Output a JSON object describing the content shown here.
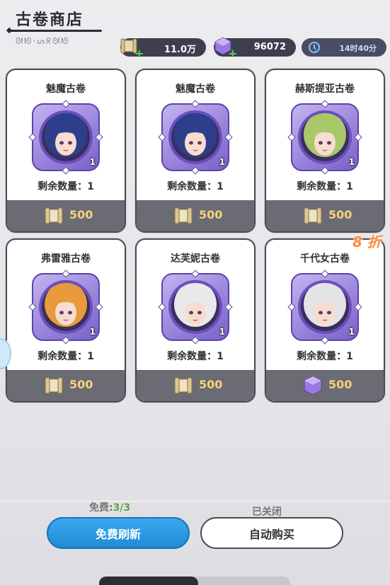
{
  "header": {
    "title": "古卷商店",
    "subtitle": "ᘛᘚ·ᔕᖇᘛᘚ"
  },
  "resources": [
    {
      "name": "scroll-currency",
      "value": "11.0万"
    },
    {
      "name": "crystal-currency",
      "value": "96072"
    },
    {
      "name": "refresh-timer",
      "value": "14时40分"
    }
  ],
  "cards": [
    {
      "name": "魅魔古卷",
      "qty": "1",
      "remain": "剩余数量：1",
      "price": "500",
      "currency": "scroll",
      "hair": "#2d3f8a"
    },
    {
      "name": "魅魔古卷",
      "qty": "1",
      "remain": "剩余数量：1",
      "price": "500",
      "currency": "scroll",
      "hair": "#2d3f8a"
    },
    {
      "name": "赫斯提亚古卷",
      "qty": "1",
      "remain": "剩余数量：1",
      "price": "500",
      "currency": "scroll",
      "hair": "#a8c86a"
    },
    {
      "name": "弗雷雅古卷",
      "qty": "1",
      "remain": "剩余数量：1",
      "price": "500",
      "currency": "scroll",
      "hair": "#e89a3c"
    },
    {
      "name": "达芙妮古卷",
      "qty": "1",
      "remain": "剩余数量：1",
      "price": "500",
      "currency": "scroll",
      "hair": "#e9e9ea"
    },
    {
      "name": "千代女古卷",
      "qty": "1",
      "remain": "剩余数量：1",
      "price": "500",
      "currency": "crystal",
      "hair": "#e4e4e8"
    }
  ],
  "discount": "8 折",
  "footer": {
    "free_prefix": "免费:",
    "free_count": "3/3",
    "closed_label": "已关闭",
    "refresh_label": "免费刷新",
    "auto_buy_label": "自动购买"
  },
  "colors": {
    "accent_blue": "#2a9ae3",
    "price_gold": "#f6d27a",
    "discount_orange": "#ff8a3a"
  }
}
